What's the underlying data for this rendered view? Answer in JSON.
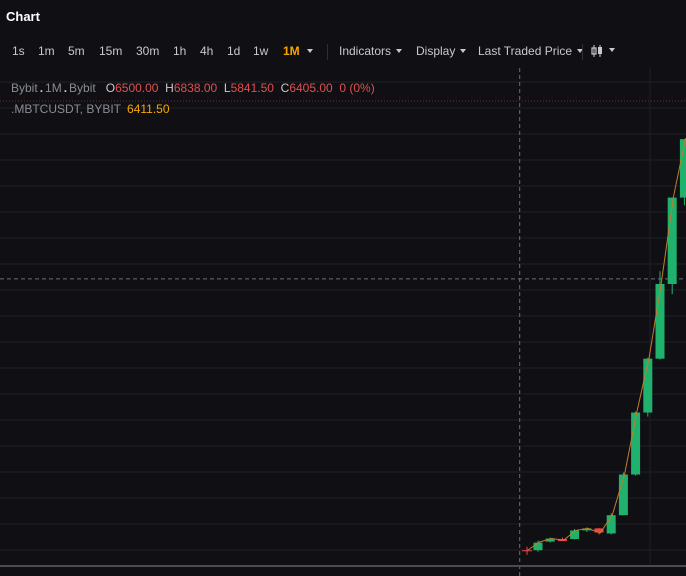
{
  "header": {
    "title": "Chart"
  },
  "toolbar": {
    "intervals": [
      "1s",
      "1m",
      "5m",
      "15m",
      "30m",
      "1h",
      "4h",
      "1d",
      "1w",
      "1M"
    ],
    "active_interval": "1M",
    "indicators_label": "Indicators",
    "display_label": "Display",
    "price_type_label": "Last Traded Price",
    "chart_type_icon": "candles-icon"
  },
  "legend": {
    "exchange": "Bybit",
    "interval": "1M",
    "source": "Bybit",
    "o_label": "O",
    "o_value": "6500.00",
    "h_label": "H",
    "h_value": "6838.00",
    "l_label": "L",
    "l_value": "5841.50",
    "c_label": "C",
    "c_value": "6405.00",
    "change": "0 (0%)",
    "index_name": ".MBTCUSDT, BYBIT",
    "index_value": "6411.50"
  },
  "colors": {
    "up": "#20b26c",
    "down": "#ef454a",
    "accent": "#f7a600",
    "index_line": "#c77b2a",
    "background": "#101014",
    "grid": "#1e1f24"
  },
  "chart_data": {
    "type": "candlestick",
    "series": [
      {
        "name": "Bybit",
        "kind": "candles",
        "values": [
          {
            "o": 1110,
            "h": 1300,
            "l": 1080,
            "c": 1260
          },
          {
            "o": 1280,
            "h": 1360,
            "l": 1260,
            "c": 1340
          },
          {
            "o": 1330,
            "h": 1360,
            "l": 1290,
            "c": 1300
          },
          {
            "o": 1330,
            "h": 1530,
            "l": 1320,
            "c": 1500
          },
          {
            "o": 1500,
            "h": 1560,
            "l": 1470,
            "c": 1540
          },
          {
            "o": 1540,
            "h": 1550,
            "l": 1420,
            "c": 1460
          },
          {
            "o": 1440,
            "h": 1840,
            "l": 1420,
            "c": 1800
          },
          {
            "o": 1800,
            "h": 2640,
            "l": 1800,
            "c": 2600
          },
          {
            "o": 2600,
            "h": 3840,
            "l": 2580,
            "c": 3820
          },
          {
            "o": 3820,
            "h": 4900,
            "l": 3740,
            "c": 4880
          },
          {
            "o": 4880,
            "h": 6600,
            "l": 4860,
            "c": 6350
          },
          {
            "o": 6350,
            "h": 7500,
            "l": 6150,
            "c": 8050
          },
          {
            "o": 8050,
            "h": 8600,
            "l": 7900,
            "c": 9200
          },
          {
            "o": 9250,
            "h": 9300,
            "l": 9100,
            "c": 9150
          }
        ]
      },
      {
        "name": ".MBTCUSDT, BYBIT",
        "kind": "line",
        "values": [
          1100,
          1270,
          1340,
          1310,
          1500,
          1540,
          1450,
          1810,
          2610,
          3830,
          4890,
          6360,
          8060,
          9220
        ]
      }
    ],
    "ylim": [
      800,
      10600
    ],
    "crosshair_x_index": -1.5,
    "crosshair_y": 6450,
    "highest_price_line": 9950
  }
}
